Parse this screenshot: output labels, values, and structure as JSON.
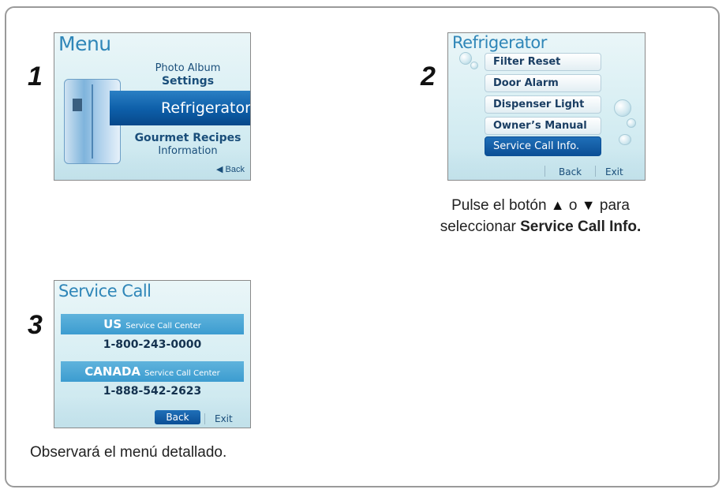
{
  "steps": {
    "one": "1",
    "two": "2",
    "three": "3"
  },
  "screen1": {
    "title": "Menu",
    "items": {
      "photo_album": "Photo Album",
      "settings": "Settings",
      "refrigerator": "Refrigerator",
      "gourmet_recipes": "Gourmet Recipes",
      "information": "Information"
    },
    "back": "◀ Back"
  },
  "screen2": {
    "title": "Refrigerator",
    "items": [
      "Filter Reset",
      "Door Alarm",
      "Dispenser Light",
      "Owner’s Manual",
      "Service Call Info."
    ],
    "selected_index": 4,
    "back": "Back",
    "exit": "Exit"
  },
  "screen3": {
    "title": "Service Call",
    "us_label": "US",
    "us_suffix": "Service Call Center",
    "us_phone": "1-800-243-0000",
    "ca_label": "CANADA",
    "ca_suffix": "Service Call Center",
    "ca_phone": "1-888-542-2623",
    "back": "Back",
    "exit": "Exit"
  },
  "captions": {
    "step2_line1_a": "Pulse el botón",
    "up_arrow": "▲",
    "or": "o",
    "down_arrow": "▼",
    "step2_line1_b": "para",
    "step2_line2_a": "seleccionar",
    "step2_line2_b": "Service Call Info.",
    "step3": "Observará el menú detallado."
  }
}
